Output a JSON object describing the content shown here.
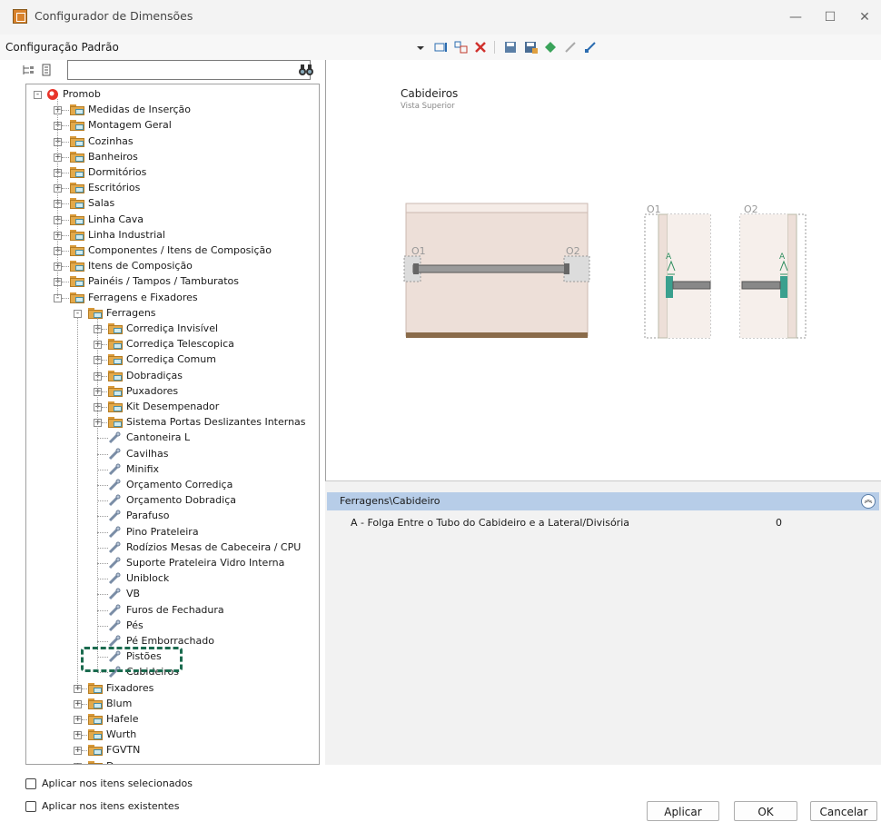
{
  "window": {
    "title": "Configurador de Dimensões",
    "minimize": "—",
    "maximize": "☐",
    "close": "✕"
  },
  "toolbar": {
    "config_label": "Configuração Padrão"
  },
  "search": {
    "value": "",
    "placeholder": ""
  },
  "tree": {
    "root": "Promob",
    "top_items": [
      "Medidas de Inserção",
      "Montagem Geral",
      "Cozinhas",
      "Banheiros",
      "Dormitórios",
      "Escritórios",
      "Salas",
      "Linha Cava",
      "Linha Industrial",
      "Componentes / Itens de Composição",
      "Itens de Composição",
      "Painéis / Tampos / Tamburatos",
      "Ferragens e Fixadores"
    ],
    "ferragens_group": "Ferragens",
    "ferragens_folders": [
      "Corrediça Invisível",
      "Corrediça Telescopica",
      "Corrediça Comum",
      "Dobradiças",
      "Puxadores",
      "Kit Desempenador",
      "Sistema Portas Deslizantes Internas"
    ],
    "ferragens_leaves": [
      "Cantoneira L",
      "Cavilhas",
      "Minifix",
      "Orçamento Corrediça",
      "Orçamento Dobradiça",
      "Parafuso",
      "Pino Prateleira",
      "Rodízios Mesas de Cabeceira / CPU",
      "Suporte Prateleira Vidro Interna",
      "Uniblock",
      "VB",
      "Furos de Fechadura",
      "Pés",
      "Pé Emborrachado",
      "Pistões",
      "Cabideiros"
    ],
    "after_folders": [
      "Fixadores",
      "Blum",
      "Hafele",
      "Wurth",
      "FGVTN",
      "Dancamac"
    ],
    "selected": "Cabideiros"
  },
  "checkboxes": {
    "selected_items": "Aplicar nos itens selecionados",
    "existing_items": "Aplicar nos itens existentes"
  },
  "preview": {
    "title": "Cabideiros",
    "subtitle": "Vista Superior",
    "label_o1": "O1",
    "label_o2": "O2",
    "label_a": "A"
  },
  "properties": {
    "group": "Ferragens\\Cabideiro",
    "row_name": "A - Folga Entre o Tubo do Cabideiro e a Lateral/Divisória",
    "row_value": "0"
  },
  "buttons": {
    "apply": "Aplicar",
    "ok": "OK",
    "cancel": "Cancelar"
  }
}
